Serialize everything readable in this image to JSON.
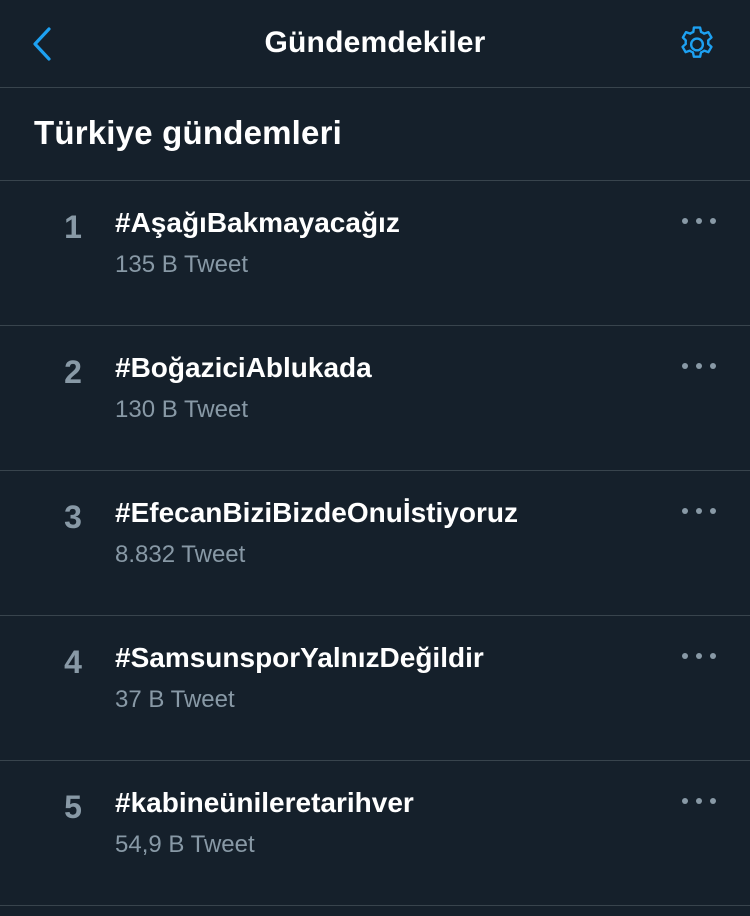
{
  "header": {
    "title": "Gündemdekiler",
    "back_icon": "chevron-left-icon",
    "settings_icon": "gear-icon",
    "accent_color": "#1da1f2"
  },
  "section": {
    "title": "Türkiye gündemleri"
  },
  "trends": [
    {
      "rank": "1",
      "name": "#AşağıBakmayacağız",
      "count": "135 B Tweet"
    },
    {
      "rank": "2",
      "name": "#BoğaziciAblukada",
      "count": "130 B Tweet"
    },
    {
      "rank": "3",
      "name": "#EfecanBiziBizdeOnuİstiyoruz",
      "count": "8.832 Tweet"
    },
    {
      "rank": "4",
      "name": "#SamsunsporYalnızDeğildir",
      "count": "37 B Tweet"
    },
    {
      "rank": "5",
      "name": "#kabineünileretarihver",
      "count": "54,9 B Tweet"
    }
  ],
  "colors": {
    "background": "#15202b",
    "divider": "#38444d",
    "secondary_text": "#8899a6",
    "primary_text": "#ffffff"
  }
}
